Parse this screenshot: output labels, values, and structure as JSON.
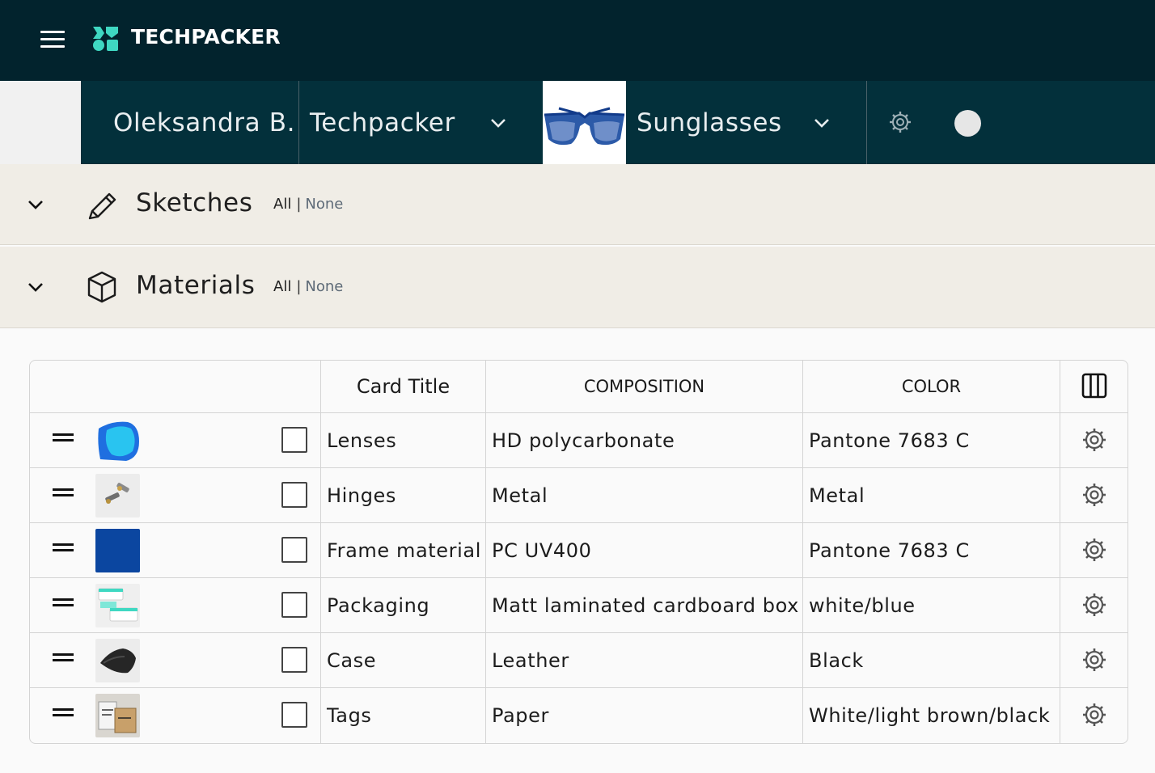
{
  "topbar": {
    "brand": "TECHPACKER",
    "brand_color": "#3fd8c2",
    "background": "#02232d"
  },
  "subbar": {
    "user": "Oleksandra B.",
    "workspace": "Techpacker",
    "product": "Sunglasses"
  },
  "sections": [
    {
      "title": "Sketches",
      "icon": "pencil-icon",
      "all_label": "All",
      "sep": "|",
      "none_label": "None"
    },
    {
      "title": "Materials",
      "icon": "box-icon",
      "all_label": "All",
      "sep": "|",
      "none_label": "None"
    }
  ],
  "table": {
    "headers": {
      "card_title": "Card Title",
      "composition": "COMPOSITION",
      "color": "COLOR"
    },
    "rows": [
      {
        "title": "Lenses",
        "composition": "HD polycarbonate",
        "color": "Pantone 7683 C",
        "thumb": "lens-thumbnail"
      },
      {
        "title": "Hinges",
        "composition": "Metal",
        "color": "Metal",
        "thumb": "hinges-thumbnail"
      },
      {
        "title": "Frame material",
        "composition": "PC UV400",
        "color": "Pantone 7683 C",
        "thumb": "frame-swatch"
      },
      {
        "title": "Packaging",
        "composition": "Matt laminated cardboard box",
        "color": "white/blue",
        "thumb": "packaging-thumbnail"
      },
      {
        "title": "Case",
        "composition": "Leather",
        "color": "Black",
        "thumb": "case-thumbnail"
      },
      {
        "title": "Tags",
        "composition": "Paper",
        "color": "White/light brown/black",
        "thumb": "tags-thumbnail"
      }
    ]
  },
  "colors": {
    "accent_teal": "#3fd8c2",
    "frame_blue": "#0b46a0",
    "section_bg": "#f0ede6"
  }
}
